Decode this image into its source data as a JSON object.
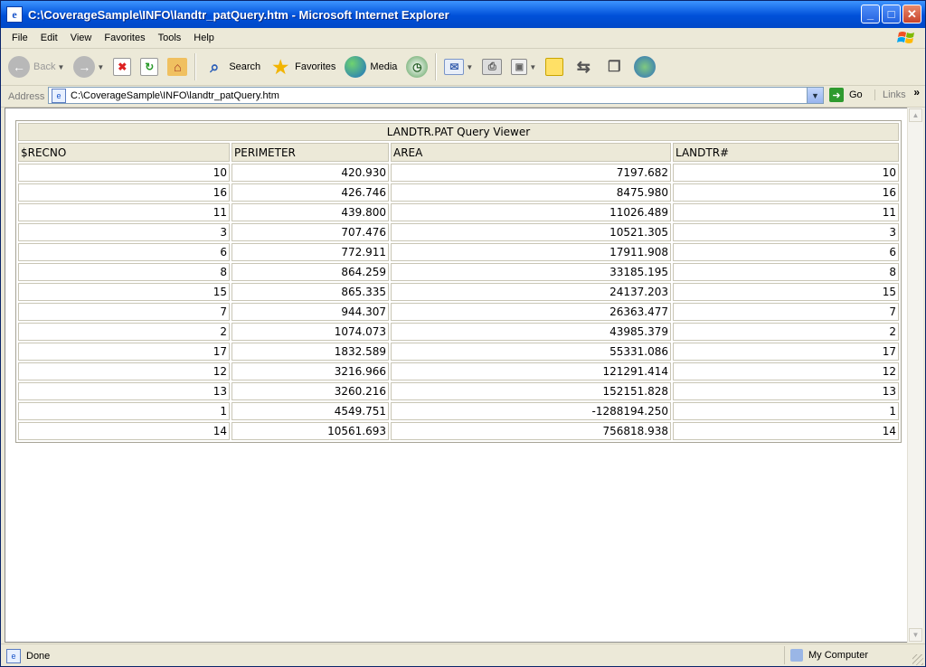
{
  "window": {
    "title": "C:\\CoverageSample\\INFO\\landtr_patQuery.htm - Microsoft Internet Explorer"
  },
  "menu": [
    "File",
    "Edit",
    "View",
    "Favorites",
    "Tools",
    "Help"
  ],
  "toolbar": {
    "back": "Back",
    "search": "Search",
    "favorites": "Favorites",
    "media": "Media"
  },
  "address": {
    "label": "Address",
    "url": "C:\\CoverageSample\\INFO\\landtr_patQuery.htm",
    "go": "Go",
    "links": "Links"
  },
  "table": {
    "caption": "LANDTR.PAT Query Viewer",
    "columns": [
      "$RECNO",
      "PERIMETER",
      "AREA",
      "LANDTR#"
    ],
    "rows": [
      [
        "10",
        "420.930",
        "7197.682",
        "10"
      ],
      [
        "16",
        "426.746",
        "8475.980",
        "16"
      ],
      [
        "11",
        "439.800",
        "11026.489",
        "11"
      ],
      [
        "3",
        "707.476",
        "10521.305",
        "3"
      ],
      [
        "6",
        "772.911",
        "17911.908",
        "6"
      ],
      [
        "8",
        "864.259",
        "33185.195",
        "8"
      ],
      [
        "15",
        "865.335",
        "24137.203",
        "15"
      ],
      [
        "7",
        "944.307",
        "26363.477",
        "7"
      ],
      [
        "2",
        "1074.073",
        "43985.379",
        "2"
      ],
      [
        "17",
        "1832.589",
        "55331.086",
        "17"
      ],
      [
        "12",
        "3216.966",
        "121291.414",
        "12"
      ],
      [
        "13",
        "3260.216",
        "152151.828",
        "13"
      ],
      [
        "1",
        "4549.751",
        "-1288194.250",
        "1"
      ],
      [
        "14",
        "10561.693",
        "756818.938",
        "14"
      ]
    ]
  },
  "status": {
    "text": "Done",
    "zone": "My Computer"
  }
}
